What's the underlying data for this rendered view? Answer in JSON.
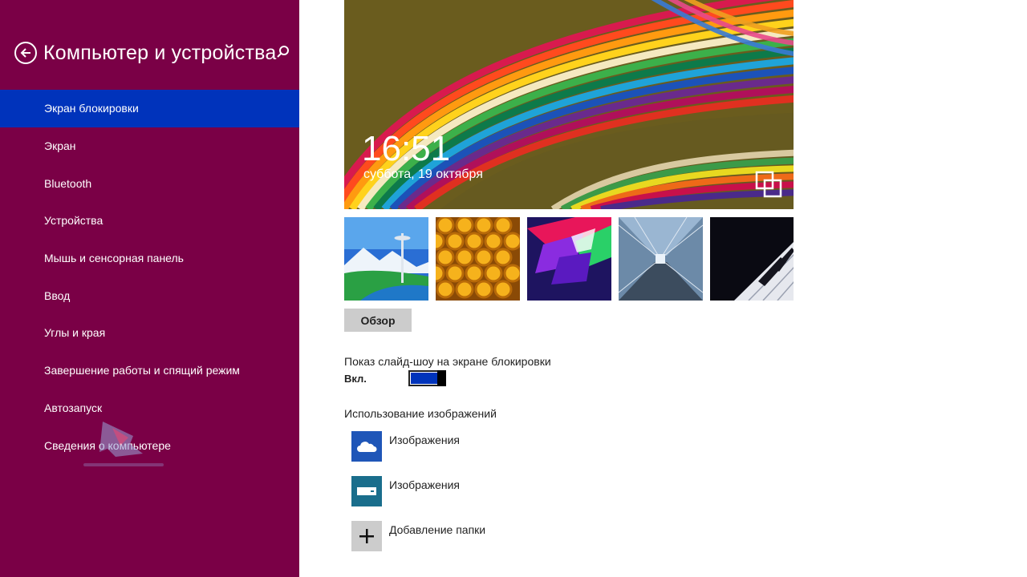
{
  "sidebar": {
    "title": "Компьютер и устройства",
    "items": [
      {
        "label": "Экран блокировки",
        "active": true
      },
      {
        "label": "Экран"
      },
      {
        "label": "Bluetooth"
      },
      {
        "label": "Устройства"
      },
      {
        "label": "Мышь и сенсорная панель"
      },
      {
        "label": "Ввод"
      },
      {
        "label": "Углы и края"
      },
      {
        "label": "Завершение работы и спящий режим"
      },
      {
        "label": "Автозапуск"
      },
      {
        "label": "Сведения о компьютере"
      }
    ],
    "icons": {
      "back": "back-arrow-icon",
      "search": "search-icon"
    }
  },
  "preview": {
    "time": "16:51",
    "date": "суббота, 19 октября",
    "icon": "camera-switch-icon"
  },
  "thumbnails": [
    {
      "name": "space-needle-thumbnail"
    },
    {
      "name": "honeycomb-thumbnail"
    },
    {
      "name": "geometric-shapes-thumbnail"
    },
    {
      "name": "tunnel-thumbnail"
    },
    {
      "name": "piano-keys-thumbnail"
    }
  ],
  "browse_button": "Обзор",
  "slideshow": {
    "label": "Показ слайд-шоу на экране блокировки",
    "value": "Вкл.",
    "on": true
  },
  "images_section": {
    "label": "Использование изображений",
    "items": [
      {
        "label": "Изображения",
        "icon": "onedrive-cloud-icon",
        "color": "#1f56b8"
      },
      {
        "label": "Изображения",
        "icon": "local-drive-icon",
        "color": "#1a6e8c"
      },
      {
        "label": "Добавление папки",
        "icon": "plus-icon",
        "color": "#cccccc"
      }
    ]
  },
  "colors": {
    "sidebar_bg": "#7a0046",
    "accent": "#0033bb"
  }
}
